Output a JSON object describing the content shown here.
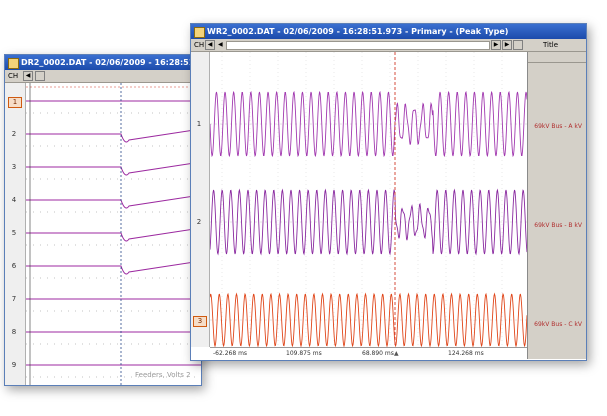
{
  "back_window": {
    "title": "DR2_0002.DAT - 02/06/2009 - 16:28:51.973",
    "toolbar": {
      "ch_label": "CH",
      "nav_left": "◀"
    },
    "channels": [
      "1",
      "2",
      "3",
      "4",
      "5",
      "6",
      "7",
      "8",
      "9"
    ],
    "selected_channel": "1",
    "footer_text": "Feeders, Volts 2"
  },
  "front_window": {
    "title": "WR2_0002.DAT - 02/06/2009 - 16:28:51.973 - Primary - (Peak Type)",
    "toolbar": {
      "ch_label": "CH",
      "nav_left": "◀",
      "left_arrow": "◀",
      "nav_right": "▶",
      "play": "▶",
      "title_col": "Title"
    },
    "channels": [
      "1",
      "2",
      "3"
    ],
    "selected_channel": "3",
    "channel_labels": [
      "69kV Bus - A kV",
      "69kV Bus - B kV",
      "69kV Bus - C kV"
    ],
    "time_axis": [
      "-62.268 ms",
      "109.875 ms",
      "68.890 ms",
      "124.268 ms"
    ],
    "colors": {
      "phase_a": "#a23ab0",
      "phase_b": "#8a2aa0",
      "phase_c": "#e0461a",
      "cursor": "#d23a2a",
      "grid": "#c8c8c8"
    }
  }
}
